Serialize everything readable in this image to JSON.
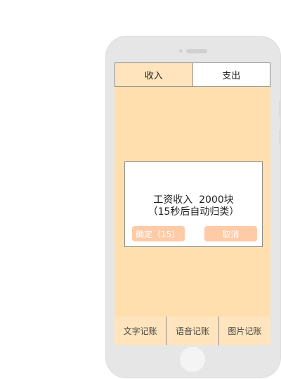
{
  "tabs": {
    "income": "收入",
    "expense": "支出"
  },
  "dialog": {
    "message": "工资收入  2000块",
    "countdown_note": "（15秒后自动归类）",
    "confirm_label": "确定（15）",
    "cancel_label": "取消"
  },
  "bottom_bar": {
    "text_entry": "文字记账",
    "voice_entry": "语音记账",
    "photo_entry": "图片记账"
  },
  "colors": {
    "screen_background": "#ffdfae",
    "tab_active": "#ffe4bd",
    "button": "#ffcaa6",
    "phone_frame": "#e6e6e6"
  }
}
